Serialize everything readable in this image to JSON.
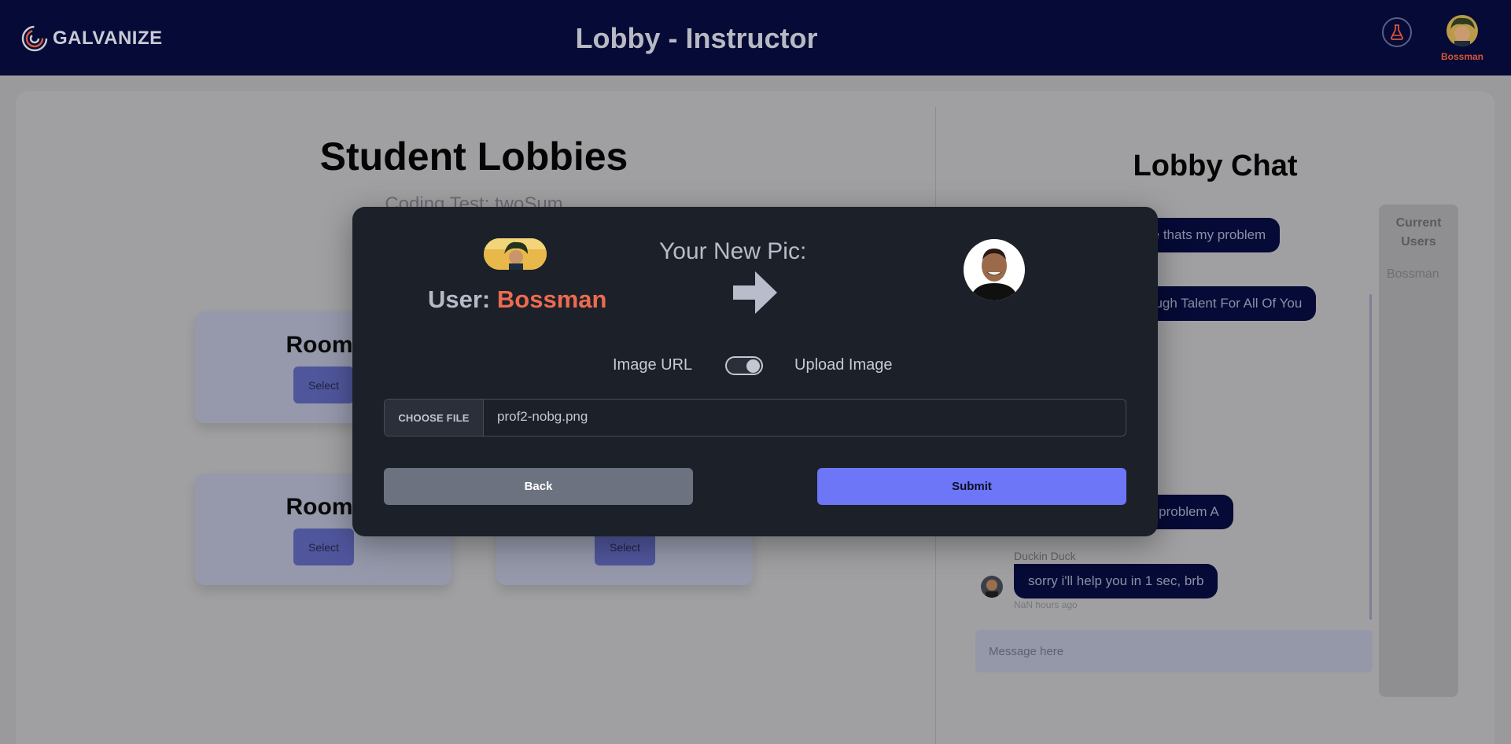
{
  "header": {
    "logo_text": "GALVANIZE",
    "title": "Lobby - Instructor",
    "user_name": "Bossman",
    "lab_icon": "flask-icon",
    "accent": "#050a36",
    "username_color": "#d8563a"
  },
  "lobbies": {
    "title": "Student Lobbies",
    "subtitle": "Coding Test: twoSum",
    "rooms": [
      {
        "title": "Room:",
        "select_label": "Select"
      },
      {
        "title": "Room:",
        "select_label": "Select"
      },
      {
        "title": "",
        "select_label": "Select"
      }
    ]
  },
  "chat": {
    "title": "Lobby Chat",
    "users_panel_title": "Current Users",
    "users": [
      "Bossman"
    ],
    "messages": [
      {
        "text": "re thats my problem"
      },
      {
        "text": "ough Talent For All Of You"
      },
      {
        "text": "n problem A"
      },
      {
        "sender": "Duckin Duck",
        "text": "sorry i'll help you in 1 sec, brb",
        "time": "NaN hours ago"
      }
    ],
    "input_placeholder": "Message here"
  },
  "modal": {
    "user_label": "User:",
    "user_name": "Bossman",
    "new_pic_label": "Your New Pic:",
    "toggle_left_label": "Image URL",
    "toggle_right_label": "Upload Image",
    "toggle_state": "upload",
    "choose_file_label": "CHOOSE FILE",
    "file_name": "prof2-nobg.png",
    "back_label": "Back",
    "submit_label": "Submit",
    "submit_color": "#6d76f7"
  }
}
